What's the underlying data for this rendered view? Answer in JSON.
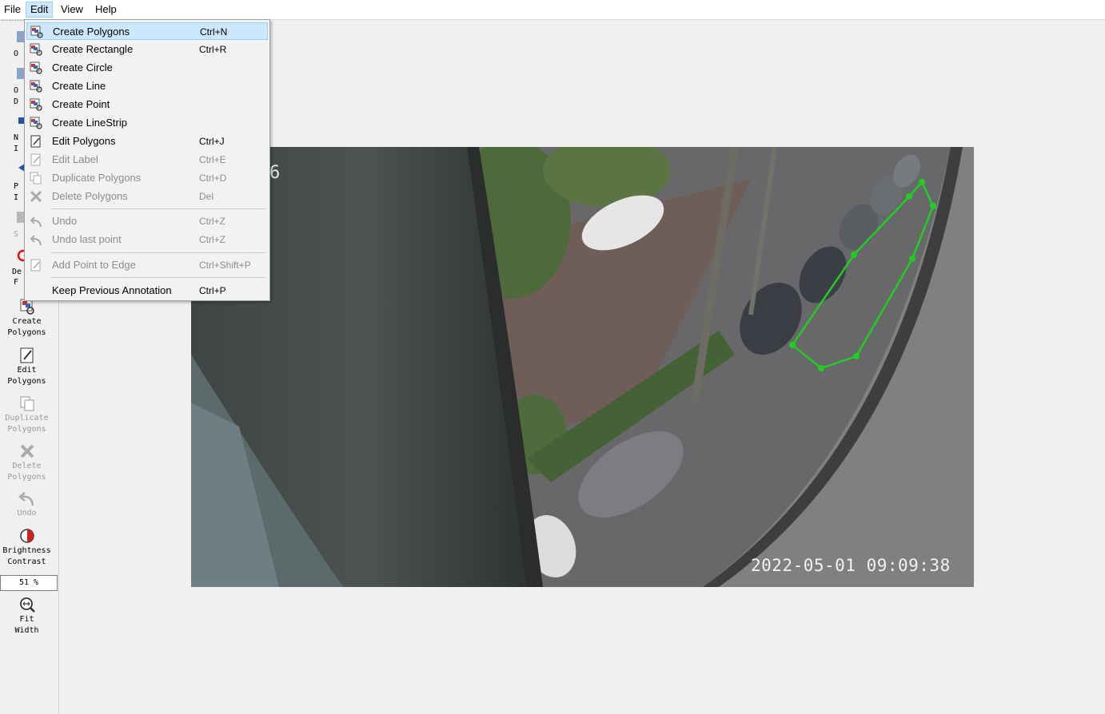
{
  "menubar": {
    "items": [
      "File",
      "Edit",
      "View",
      "Help"
    ]
  },
  "edit_menu": {
    "items": [
      {
        "label": "Create Polygons",
        "shortcut": "Ctrl+N",
        "icon": "create-polygon-icon",
        "enabled": true,
        "highlighted": true
      },
      {
        "label": "Create Rectangle",
        "shortcut": "Ctrl+R",
        "icon": "create-polygon-icon",
        "enabled": true
      },
      {
        "label": "Create Circle",
        "shortcut": "",
        "icon": "create-polygon-icon",
        "enabled": true
      },
      {
        "label": "Create Line",
        "shortcut": "",
        "icon": "create-polygon-icon",
        "enabled": true
      },
      {
        "label": "Create Point",
        "shortcut": "",
        "icon": "create-polygon-icon",
        "enabled": true
      },
      {
        "label": "Create LineStrip",
        "shortcut": "",
        "icon": "create-polygon-icon",
        "enabled": true
      },
      {
        "label": "Edit Polygons",
        "shortcut": "Ctrl+J",
        "icon": "edit-icon",
        "enabled": true
      },
      {
        "label": "Edit Label",
        "shortcut": "Ctrl+E",
        "icon": "edit-icon",
        "enabled": false
      },
      {
        "label": "Duplicate Polygons",
        "shortcut": "Ctrl+D",
        "icon": "copy-icon",
        "enabled": false
      },
      {
        "label": "Delete Polygons",
        "shortcut": "Del",
        "icon": "cross-icon",
        "enabled": false
      },
      {
        "label": "Undo",
        "shortcut": "Ctrl+Z",
        "icon": "undo-icon",
        "enabled": false
      },
      {
        "label": "Undo last point",
        "shortcut": "Ctrl+Z",
        "icon": "undo-icon",
        "enabled": false
      },
      {
        "label": "Add Point to Edge",
        "shortcut": "Ctrl+Shift+P",
        "icon": "edit-icon",
        "enabled": false
      },
      {
        "label": "Keep Previous Annotation",
        "shortcut": "Ctrl+P",
        "icon": "",
        "enabled": true
      }
    ]
  },
  "toolbar": {
    "partial": [
      "O",
      "O",
      "D",
      "N",
      "I",
      "P",
      "I",
      "S",
      "De",
      "F"
    ],
    "create_polygons": [
      "Create",
      "Polygons"
    ],
    "edit_polygons": [
      "Edit",
      "Polygons"
    ],
    "duplicate_polygons": [
      "Duplicate",
      "Polygons"
    ],
    "delete_polygons": [
      "Delete",
      "Polygons"
    ],
    "undo": "Undo",
    "brightness_contrast": [
      "Brightness",
      "Contrast"
    ],
    "zoom": "51 %",
    "fit_width": [
      "Fit",
      "Width"
    ]
  },
  "canvas": {
    "timestamp": "2022-05-01 09:09:38",
    "camera_label_fragment": "6"
  },
  "colors": {
    "polygon": "#22cc22",
    "highlight": "#cce8ff"
  }
}
